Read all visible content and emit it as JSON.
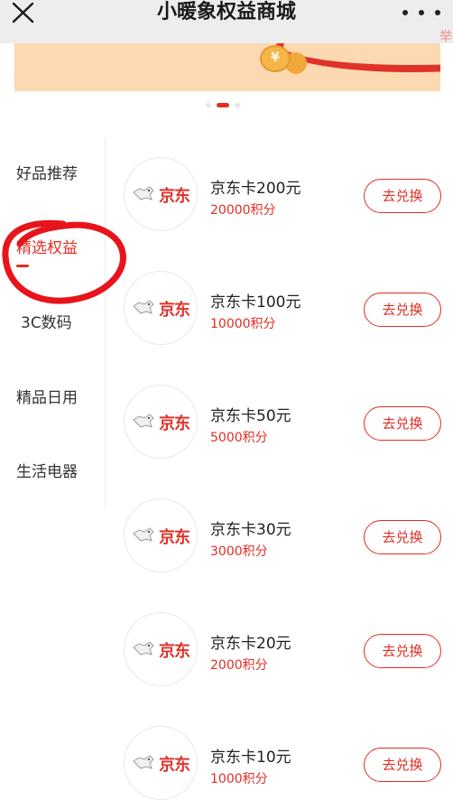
{
  "header": {
    "title": "小暖象权益商城",
    "report_label": "举报"
  },
  "banner": {
    "coin_symbol": "¥",
    "carousel_total": 3,
    "carousel_active": 2
  },
  "sidebar": {
    "items": [
      {
        "label": "好品推荐",
        "active": false
      },
      {
        "label": "精选权益",
        "active": true
      },
      {
        "label": "3C数码",
        "active": false
      },
      {
        "label": "精品日用",
        "active": false
      },
      {
        "label": "生活电器",
        "active": false
      }
    ]
  },
  "products": [
    {
      "logo_text": "京东",
      "name": "京东卡200元",
      "points": "20000积分",
      "button": "去兑换"
    },
    {
      "logo_text": "京东",
      "name": "京东卡100元",
      "points": "10000积分",
      "button": "去兑换"
    },
    {
      "logo_text": "京东",
      "name": "京东卡50元",
      "points": "5000积分",
      "button": "去兑换"
    },
    {
      "logo_text": "京东",
      "name": "京东卡30元",
      "points": "3000积分",
      "button": "去兑换"
    },
    {
      "logo_text": "京东",
      "name": "京东卡20元",
      "points": "2000积分",
      "button": "去兑换"
    },
    {
      "logo_text": "京东",
      "name": "京东卡10元",
      "points": "1000积分",
      "button": "去兑换"
    }
  ],
  "colors": {
    "accent": "#e02e24",
    "header_bg": "#ededed",
    "banner_bg": "#fcd9b1",
    "annotation": "#e8141c"
  },
  "icons": [
    "close-icon",
    "more-icon",
    "jd-dog-icon",
    "coin-icon"
  ]
}
